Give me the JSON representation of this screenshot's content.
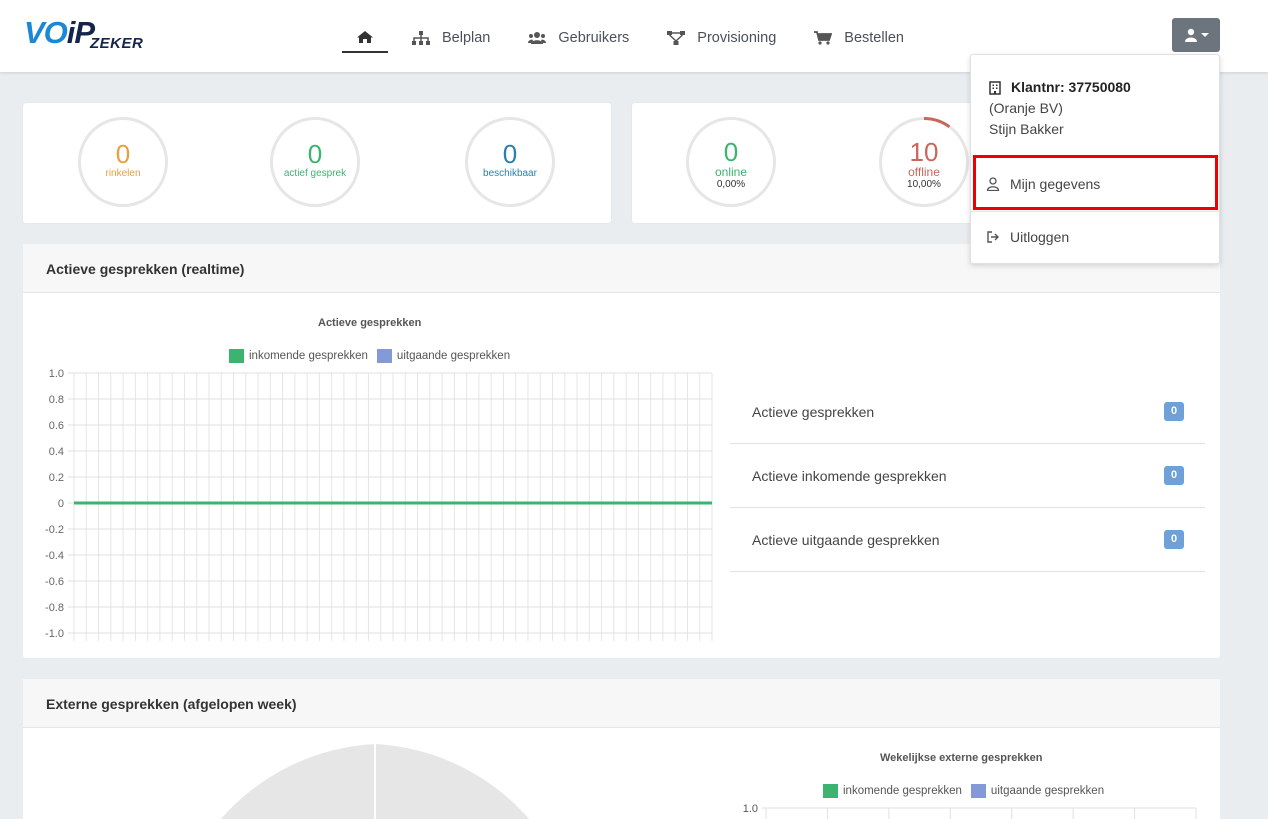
{
  "brand": {
    "logo_text_voip": "VOiP",
    "logo_text_zeker": "ZEKER",
    "accent": "#1b88d6",
    "dark": "#14244a"
  },
  "nav": {
    "items": [
      {
        "label": "",
        "icon": "home-icon"
      },
      {
        "label": "Belplan",
        "icon": "sitemap-icon"
      },
      {
        "label": "Gebruikers",
        "icon": "users-icon"
      },
      {
        "label": "Provisioning",
        "icon": "network-icon"
      },
      {
        "label": "Bestellen",
        "icon": "cart-icon"
      }
    ]
  },
  "stats_left": [
    {
      "value": "0",
      "label": "rinkelen",
      "color": "#e8a03c"
    },
    {
      "value": "0",
      "label": "actief gesprek",
      "color": "#3cb371"
    },
    {
      "value": "0",
      "label": "beschikbaar",
      "color": "#2a7fb0"
    }
  ],
  "stats_right": [
    {
      "value": "0",
      "label": "online",
      "percent": "0,00%",
      "color": "#3cb371"
    },
    {
      "value": "10",
      "label": "offline",
      "percent": "10,00%",
      "color": "#c9685a",
      "progress": 0.1
    }
  ],
  "section_active": {
    "title": "Actieve gesprekken (realtime)",
    "rows": [
      {
        "label": "Actieve gesprekken",
        "count": "0"
      },
      {
        "label": "Actieve inkomende gesprekken",
        "count": "0"
      },
      {
        "label": "Actieve uitgaande gesprekken",
        "count": "0"
      }
    ]
  },
  "chart_data": [
    {
      "type": "line",
      "title": "Actieve gesprekken",
      "series": [
        {
          "name": "inkomende gesprekken",
          "color": "#3cb371",
          "values": [
            0,
            0,
            0,
            0,
            0,
            0,
            0,
            0,
            0,
            0
          ]
        },
        {
          "name": "uitgaande gesprekken",
          "color": "#8399d8",
          "values": [
            0,
            0,
            0,
            0,
            0,
            0,
            0,
            0,
            0,
            0
          ]
        }
      ],
      "yticks": [
        "1.0",
        "0.8",
        "0.6",
        "0.4",
        "0.2",
        "0",
        "-0.2",
        "-0.4",
        "-0.6",
        "-0.8",
        "-1.0"
      ],
      "ylim": [
        -1.0,
        1.0
      ],
      "grid": true,
      "legend": "top"
    },
    {
      "type": "bar",
      "title": "Wekelijkse externe gesprekken",
      "series": [
        {
          "name": "inkomende gesprekken",
          "color": "#3cb371"
        },
        {
          "name": "uitgaande gesprekken",
          "color": "#8399d8"
        }
      ],
      "yticks": [
        "1.0"
      ],
      "legend": "top"
    }
  ],
  "section_external": {
    "title": "Externe gesprekken (afgelopen week)"
  },
  "user_menu": {
    "klantnr": "Klantnr: 37750080",
    "company": "(Oranje BV)",
    "name": "Stijn Bakker",
    "mijn_gegevens": "Mijn gegevens",
    "uitloggen": "Uitloggen"
  }
}
